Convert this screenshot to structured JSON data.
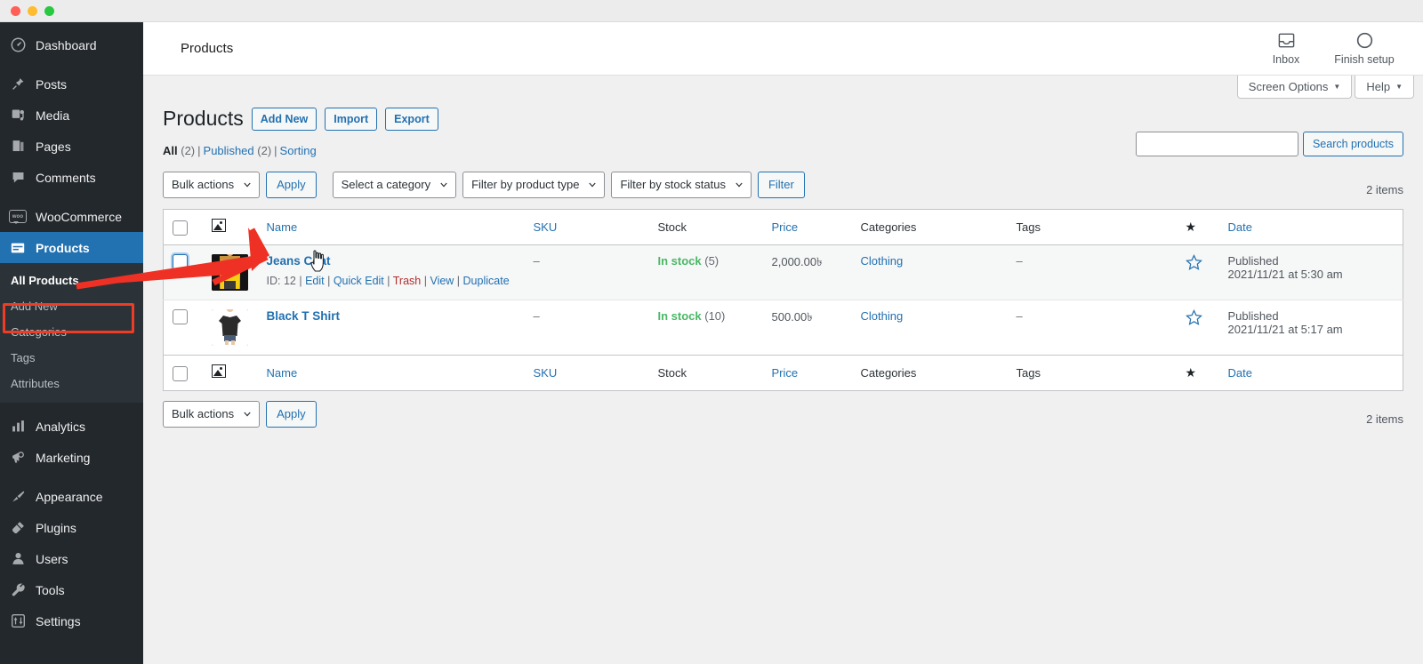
{
  "window": {
    "traffic_lights": [
      "close",
      "minimize",
      "maximize"
    ]
  },
  "sidebar": {
    "items": [
      {
        "label": "Dashboard",
        "icon": "dashboard-icon"
      },
      {
        "label": "Posts",
        "icon": "pin-icon"
      },
      {
        "label": "Media",
        "icon": "media-icon"
      },
      {
        "label": "Pages",
        "icon": "pages-icon"
      },
      {
        "label": "Comments",
        "icon": "comments-icon"
      },
      {
        "label": "WooCommerce",
        "icon": "woo-icon"
      },
      {
        "label": "Products",
        "icon": "products-icon"
      },
      {
        "label": "Analytics",
        "icon": "analytics-icon"
      },
      {
        "label": "Marketing",
        "icon": "megaphone-icon"
      },
      {
        "label": "Appearance",
        "icon": "brush-icon"
      },
      {
        "label": "Plugins",
        "icon": "plug-icon"
      },
      {
        "label": "Users",
        "icon": "user-icon"
      },
      {
        "label": "Tools",
        "icon": "wrench-icon"
      },
      {
        "label": "Settings",
        "icon": "sliders-icon"
      }
    ],
    "submenu": [
      {
        "label": "All Products",
        "current": true
      },
      {
        "label": "Add New",
        "current": false
      },
      {
        "label": "Categories",
        "current": false
      },
      {
        "label": "Tags",
        "current": false
      },
      {
        "label": "Attributes",
        "current": false
      }
    ],
    "active_item": "Products",
    "highlight_color": "#ef3c24",
    "active_color": "#2271b1"
  },
  "wc_header": {
    "title": "Products",
    "inbox_label": "Inbox",
    "finish_setup_label": "Finish setup"
  },
  "screen_tabs": {
    "screen_options": "Screen Options",
    "help": "Help"
  },
  "page": {
    "title": "Products",
    "add_new": "Add New",
    "import": "Import",
    "export": "Export"
  },
  "views": {
    "all_label": "All",
    "all_count": "(2)",
    "published_label": "Published",
    "published_count": "(2)",
    "sorting_label": "Sorting"
  },
  "search": {
    "value": "",
    "placeholder": "",
    "button": "Search products"
  },
  "toolbar_top": {
    "bulk_actions": "Bulk actions",
    "apply": "Apply",
    "category": "Select a category",
    "product_type": "Filter by product type",
    "stock_status": "Filter by stock status",
    "filter": "Filter",
    "items_count": "2 items"
  },
  "toolbar_bottom": {
    "bulk_actions": "Bulk actions",
    "apply": "Apply",
    "items_count": "2 items"
  },
  "table": {
    "columns": {
      "image": "image-icon",
      "name": "Name",
      "sku": "SKU",
      "stock": "Stock",
      "price": "Price",
      "categories": "Categories",
      "tags": "Tags",
      "featured": "star-icon",
      "date": "Date"
    },
    "rows": [
      {
        "name": "Jeans Coat",
        "id_label": "ID: 12",
        "actions": [
          "Edit",
          "Quick Edit",
          "Trash",
          "View",
          "Duplicate"
        ],
        "sku": "–",
        "stock_status": "In stock",
        "stock_qty": "(5)",
        "price": "2,000.00৳",
        "categories": "Clothing",
        "tags": "–",
        "featured": false,
        "status": "Published",
        "date": "2021/11/21 at 5:30 am",
        "thumb_colors": [
          "#f2c200",
          "#1a1a1a",
          "#c98f55"
        ]
      },
      {
        "name": "Black T Shirt",
        "id_label": "",
        "actions": [],
        "sku": "–",
        "stock_status": "In stock",
        "stock_qty": "(10)",
        "price": "500.00৳",
        "categories": "Clothing",
        "tags": "–",
        "featured": false,
        "status": "Published",
        "date": "2021/11/21 at 5:17 am",
        "thumb_colors": [
          "#2b2b2b",
          "#e8c9a6",
          "#4a5d78"
        ]
      }
    ]
  },
  "annotation": {
    "arrow_color": "#ee3124",
    "cursor": "pointer-hand"
  }
}
